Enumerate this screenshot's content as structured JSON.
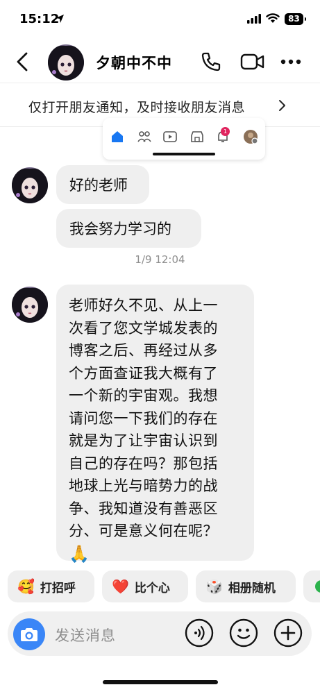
{
  "status": {
    "time": "15:12",
    "battery": "83"
  },
  "nav": {
    "name": "夕朝中不中"
  },
  "notice": {
    "text": "仅打开朋友通知，及时接收朋友消息"
  },
  "card": {
    "notification_count": "1"
  },
  "messages": [
    {
      "text": "好的老师"
    },
    {
      "text": "我会努力学习的"
    }
  ],
  "timestamp": "1/9 12:04",
  "long_message": {
    "text": "老师好久不见、从上一\n次看了您文学城发表的\n博客之后、再经过从多\n个方面查证我大概有了\n一个新的宇宙观。我想\n请问您一下我们的存在\n就是为了让宇宙认识到\n自己的存在吗？那包括\n地球上光与暗势力的战\n争、我知道没有善恶区\n分、可是意义何在呢？",
    "emoji": "🙏"
  },
  "quick_replies": [
    {
      "icon": "🥰",
      "label": "打招呼"
    },
    {
      "icon": "❤️",
      "label": "比个心"
    },
    {
      "icon": "🎲",
      "label": "相册随机"
    }
  ],
  "composer": {
    "placeholder": "发送消息"
  }
}
